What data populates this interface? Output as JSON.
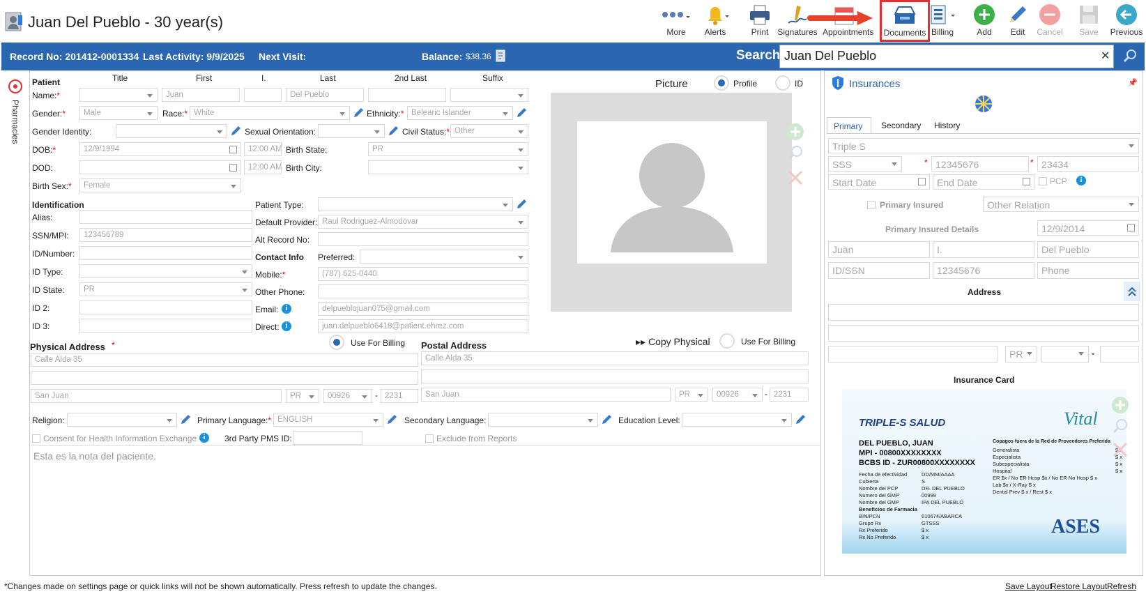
{
  "header": {
    "title": "Juan Del Pueblo - 30 year(s)",
    "toolbar": [
      {
        "label": "More",
        "icon": "more-dots-icon"
      },
      {
        "label": "Alerts",
        "icon": "bell-icon"
      },
      {
        "label": "Print",
        "icon": "printer-icon"
      },
      {
        "label": "Signatures",
        "icon": "signature-pen-icon"
      },
      {
        "label": "Appointments",
        "icon": "calendar-icon"
      },
      {
        "label": "Documents",
        "icon": "document-tray-icon"
      },
      {
        "label": "Billing",
        "icon": "billing-sheet-icon"
      },
      {
        "label": "Add",
        "icon": "add-circle-icon"
      },
      {
        "label": "Edit",
        "icon": "pencil-icon"
      },
      {
        "label": "Cancel",
        "icon": "cancel-circle-icon"
      },
      {
        "label": "Save",
        "icon": "floppy-disk-icon"
      },
      {
        "label": "Previous",
        "icon": "back-arrow-icon"
      }
    ]
  },
  "bar": {
    "record": "Record No: 201412-0001334",
    "last_activity": "Last Activity: 9/9/2025",
    "next_visit": "Next Visit:",
    "balance_label": "Balance:",
    "balance_value": "$38.36",
    "search_label": "Search:",
    "search_value": "Juan Del Pueblo"
  },
  "side_tab": "Pharmacies",
  "patient": {
    "section": "Patient",
    "col_title": "Title",
    "col_first": "First",
    "col_i": "I.",
    "col_last": "Last",
    "col_2nd_last": "2nd Last",
    "col_suffix": "Suffix",
    "name_label": "Name:",
    "first": "Juan",
    "last": "Del Pueblo",
    "gender_label": "Gender:",
    "gender": "Male",
    "race_label": "Race:",
    "race": "White",
    "ethnicity_label": "Ethnicity:",
    "ethnicity": "Belearic Islander",
    "gender_identity_label": "Gender Identity:",
    "sexual_orientation_label": "Sexual Orientation:",
    "civil_status_label": "Civil Status:",
    "civil_status": "Other",
    "dob_label": "DOB:",
    "dob": "12/9/1994",
    "dob_time": "12:00 AM",
    "birth_state_label": "Birth State:",
    "birth_state": "PR",
    "dod_label": "DOD:",
    "dod_time": "12:00 AM",
    "birth_city_label": "Birth City:",
    "birth_sex_label": "Birth Sex:",
    "birth_sex": "Female"
  },
  "identification": {
    "section": "Identification",
    "alias_label": "Alias:",
    "ssn_label": "SSN/MPI:",
    "ssn": "123456789",
    "id_number_label": "ID/Number:",
    "id_type_label": "ID Type:",
    "id_state_label": "ID State:",
    "id_state": "PR",
    "id2_label": "ID 2:",
    "id3_label": "ID 3:",
    "patient_type_label": "Patient Type:",
    "default_provider_label": "Default Provider:",
    "default_provider": "Raul Rodriguez-Almodovar",
    "alt_record_label": "Alt Record No:",
    "contact_info": "Contact Info",
    "preferred_label": "Preferred:",
    "mobile_label": "Mobile:",
    "mobile": "(787) 625-0440",
    "other_phone_label": "Other Phone:",
    "email_label": "Email:",
    "email": "delpueblojuan075@gmail.com",
    "direct_label": "Direct:",
    "direct": "juan.delpueblo6418@patient.ehrez.com"
  },
  "picture": {
    "label": "Picture",
    "profile": "Profile",
    "id": "ID"
  },
  "address": {
    "physical_title": "Physical Address",
    "use_for_billing": "Use For Billing",
    "postal_title": "Postal Address",
    "copy_physical": "Copy Physical",
    "phys_line1": "Calle Alda 35",
    "phys_city": "San Juan",
    "phys_state": "PR",
    "phys_zip": "00926",
    "phys_zip4": "2231",
    "post_line1": "Calle Alda 35",
    "post_city": "San Juan",
    "post_state": "PR",
    "post_zip": "00926",
    "post_zip4": "2231"
  },
  "misc": {
    "religion_label": "Religion:",
    "primary_language_label": "Primary Language:",
    "primary_language": "ENGLISH",
    "secondary_language_label": "Secondary Language:",
    "education_label": "Education Level:",
    "consent_label": "Consent for Health Information Exchange",
    "pms_label": "3rd Party PMS ID:",
    "exclude_label": "Exclude from Reports",
    "note": "Esta es la nota del paciente."
  },
  "insurance": {
    "title": "Insurances",
    "tabs": [
      "Primary",
      "Secondary",
      "History"
    ],
    "plan": "Triple S",
    "type": "SSS",
    "policy": "12345676",
    "group": "23434",
    "start_date": "Start Date",
    "end_date": "End Date",
    "pcp": "PCP",
    "primary_insured": "Primary Insured",
    "other_relation": "Other Relation",
    "details_title": "Primary Insured Details",
    "details_date": "12/9/2014",
    "ins_first": "Juan",
    "ins_i": "I.",
    "ins_last": "Del Pueblo",
    "ins_idssn": "ID/SSN",
    "ins_number": "12345676",
    "ins_phone": "Phone",
    "address_title": "Address",
    "state": "PR",
    "card_title": "Insurance Card"
  },
  "card": {
    "brand": "TRIPLE-S SALUD",
    "vital": "Vital",
    "name": "DEL PUEBLO, JUAN",
    "mpi": "MPI - 00800XXXXXXXX",
    "bcbs": "BCBS ID - ZUR00800XXXXXXXX",
    "left_rows": [
      [
        "Fecha de efectividad",
        "DD/MM/AAAA"
      ],
      [
        "Cubierta",
        "S"
      ],
      [
        "Nombre del PCP",
        "DR. DEL PUEBLO"
      ],
      [
        "Numero del GMP",
        "00999"
      ],
      [
        "Nombre del GMP",
        "IPA DEL PUEBLO"
      ],
      [
        "Beneficios de Farmacia",
        ""
      ],
      [
        "BIN/PCN",
        "610674/ABARCA"
      ],
      [
        "Grupo Rx",
        "GTSSS"
      ],
      [
        "Rx Preferido",
        "$ x"
      ],
      [
        "Rx No Preferido",
        "$ x"
      ]
    ],
    "copay_title": "Copagos fuera de la Red de Proveedores Preferida",
    "copays": [
      [
        "Generalista",
        "$ x"
      ],
      [
        "Especialista",
        "$ x"
      ],
      [
        "Subespecialista",
        "$ x"
      ],
      [
        "Hospital",
        "$ x"
      ],
      [
        "ER $x / No ER Hosp $x / No ER No Hosp $ x",
        ""
      ],
      [
        "Lab $x / X-Ray $ x",
        ""
      ],
      [
        "Dental Prev $ x / Rest $ x",
        ""
      ]
    ],
    "ases": "ASES"
  },
  "footer": {
    "notice": "*Changes made on settings page or quick links will not be shown automatically. Press refresh to update the changes.",
    "save_layout": "Save Layout",
    "restore_layout": "Restore Layout",
    "refresh": "Refresh"
  },
  "colors": {
    "bar": "#2b66b0",
    "accent": "#1a90e0",
    "highlight": "#e03030"
  }
}
